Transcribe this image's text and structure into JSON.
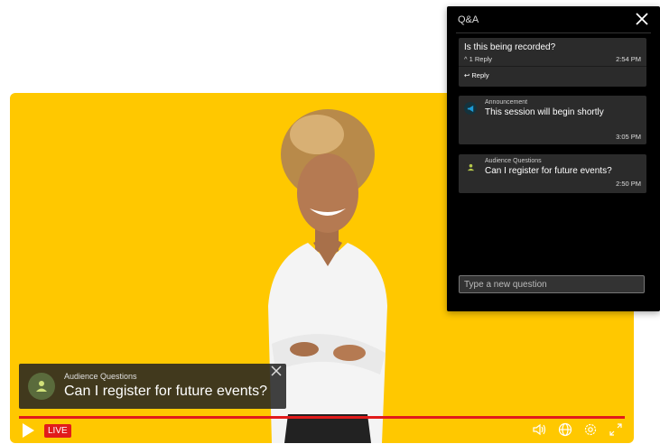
{
  "qa_panel": {
    "title": "Q&A",
    "questions": [
      {
        "text": "Is this being recorded?",
        "reply_count": "1 Reply",
        "time": "2:54 PM",
        "reply_label": "Reply"
      }
    ],
    "announcement": {
      "type": "Announcement",
      "message": "This session will begin shortly",
      "time": "3:05 PM"
    },
    "audience_question": {
      "type": "Audience Questions",
      "message": "Can I register for future events?",
      "time": "2:50 PM"
    },
    "input_placeholder": "Type a new question"
  },
  "video": {
    "caption_type": "Audience Questions",
    "caption_text": "Can I register for future events?",
    "live_label": "LIVE",
    "background_color": "#ffc800",
    "accent_color": "#e11b1b"
  }
}
